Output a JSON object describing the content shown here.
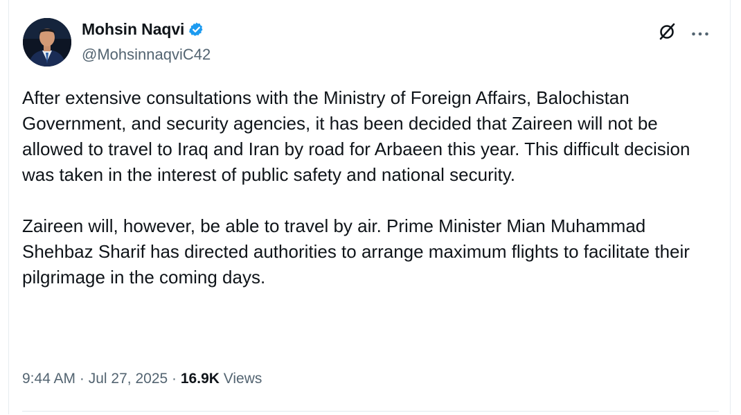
{
  "author": {
    "display_name": "Mohsin Naqvi",
    "handle": "@MohsinnaqviC42",
    "verified": true,
    "verified_color": "#1d9bf0"
  },
  "header_actions": {
    "grok_icon": "grok-slash-circle-icon",
    "more_icon": "more-dots-icon"
  },
  "post": {
    "paragraphs": [
      "After extensive consultations with the Ministry of Foreign Affairs, Balochistan Government, and security agencies, it has been decided that Zaireen will not be allowed to travel to Iraq and Iran by road for Arbaeen this year. This difficult decision was taken in the interest of public safety and national security.",
      "Zaireen will, however, be able to travel by air. Prime Minister Mian Muhammad Shehbaz Sharif has directed authorities to arrange maximum flights to facilitate their pilgrimage in the coming days."
    ]
  },
  "meta": {
    "time": "9:44 AM",
    "separator": "·",
    "date": "Jul 27, 2025",
    "views_count": "16.9K",
    "views_label": "Views"
  }
}
